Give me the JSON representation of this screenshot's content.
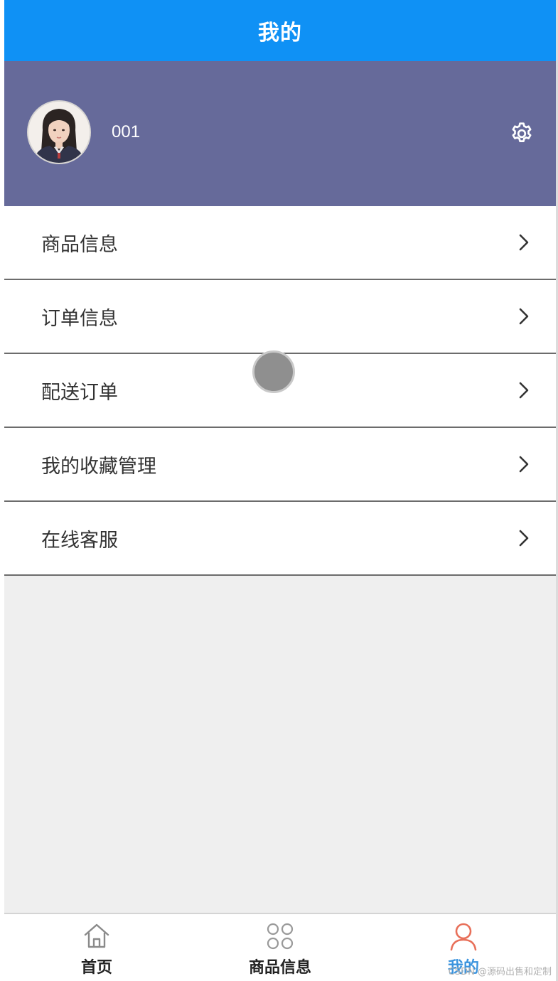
{
  "header": {
    "title": "我的"
  },
  "profile": {
    "username": "001",
    "avatar_icon": "avatar-photo",
    "settings_icon": "gear-icon",
    "background_color": "#666a9a"
  },
  "menu": {
    "items": [
      {
        "label": "商品信息"
      },
      {
        "label": "订单信息"
      },
      {
        "label": "配送订单"
      },
      {
        "label": "我的收藏管理"
      },
      {
        "label": "在线客服"
      }
    ]
  },
  "tabbar": {
    "tabs": [
      {
        "label": "首页",
        "icon": "home-icon",
        "active": false
      },
      {
        "label": "商品信息",
        "icon": "grid-icon",
        "active": false
      },
      {
        "label": "我的",
        "icon": "user-icon",
        "active": true
      }
    ],
    "active_color": "#3b94de",
    "active_icon_color": "#e8705a"
  },
  "watermark": "CSDN @源码出售和定制",
  "colors": {
    "topbar": "#0f91f5",
    "page_background": "#efefef"
  }
}
